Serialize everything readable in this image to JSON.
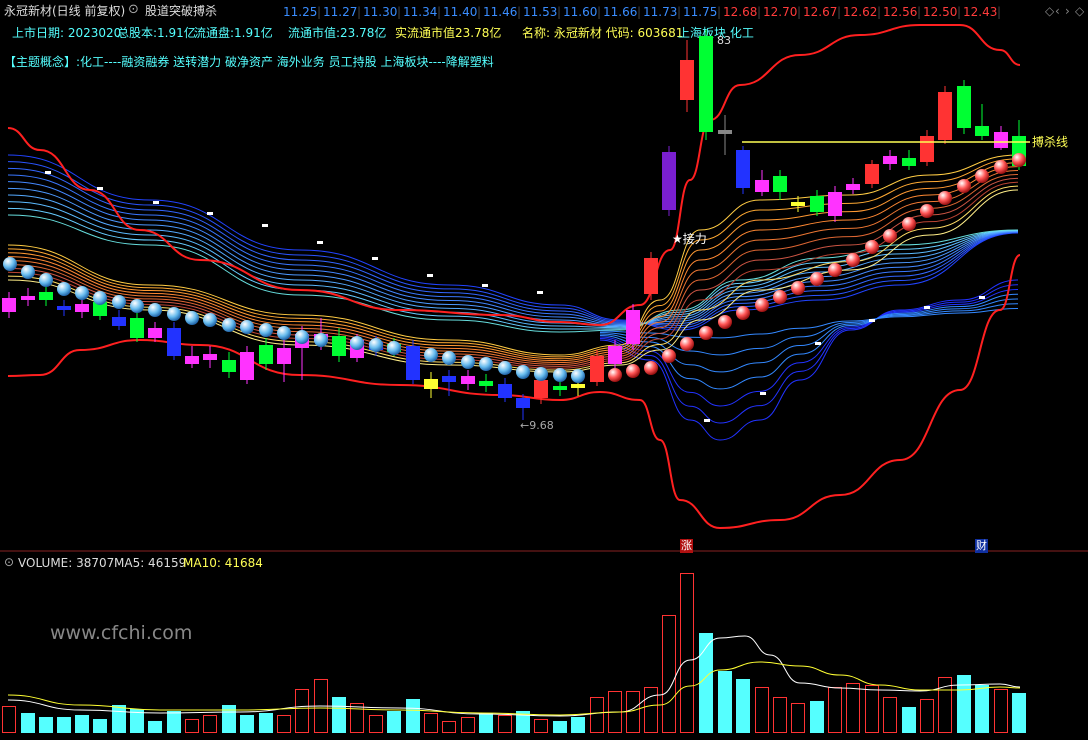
{
  "header": {
    "stock_title": "永冠新材(日线 前复权)",
    "indicator_name": "股道突破搏杀",
    "ticker_prices": [
      {
        "v": "11.25",
        "c": "#3a8dff"
      },
      {
        "v": "11.27",
        "c": "#3a8dff"
      },
      {
        "v": "11.30",
        "c": "#3a8dff"
      },
      {
        "v": "11.34",
        "c": "#3a8dff"
      },
      {
        "v": "11.40",
        "c": "#3a8dff"
      },
      {
        "v": "11.46",
        "c": "#3a8dff"
      },
      {
        "v": "11.53",
        "c": "#3a8dff"
      },
      {
        "v": "11.60",
        "c": "#3a8dff"
      },
      {
        "v": "11.66",
        "c": "#3a8dff"
      },
      {
        "v": "11.73",
        "c": "#3a8dff"
      },
      {
        "v": "11.75",
        "c": "#3a8dff"
      },
      {
        "v": "12.68",
        "c": "#ff3b3b"
      },
      {
        "v": "12.70",
        "c": "#ff3b3b"
      },
      {
        "v": "12.67",
        "c": "#ff3b3b"
      },
      {
        "v": "12.62",
        "c": "#ff3b3b"
      },
      {
        "v": "12.56",
        "c": "#ff3b3b"
      },
      {
        "v": "12.50",
        "c": "#ff3b3b"
      },
      {
        "v": "12.43",
        "c": "#ff3b3b"
      }
    ],
    "window_controls": [
      "◇",
      "‹",
      "›",
      "◇"
    ]
  },
  "info": {
    "listing_date": "上市日期: 2023020",
    "total_shares": "总股本:1.91亿",
    "float_shares": "流通盘:1.91亿",
    "float_value": "流通市值:23.78亿",
    "real_float_value": "实流通市值23.78亿",
    "name_code": "名称: 永冠新材 代码: 603681",
    "sector": "上海板块 化工",
    "concept": "【主题概念】:化工----融资融券 送转潜力 破净资产 海外业务 员工持股 上海板块----降解塑料"
  },
  "annotations": {
    "high_label": "83",
    "low_label": "←9.68",
    "support_label": "★接力",
    "kill_line_label": "搏杀线",
    "zhang_marker": "涨",
    "cai_marker": "财"
  },
  "volume": {
    "label": "VOLUME: 38707",
    "ma5": "MA5: 46159",
    "ma10": "MA10: 41684",
    "watermark": "www.cfchi.com"
  },
  "colors": {
    "up": "#ff3333",
    "down": "#00ff33",
    "blue_candle": "#2233ff",
    "magenta": "#ff33ff",
    "purple": "#7a1fd0",
    "yellow": "#ffff33",
    "cyan": "#55ffff",
    "red_line": "#ff2020",
    "kill_line": "#ffff55"
  },
  "chart_data": {
    "type": "candlestick",
    "price_min": 9.68,
    "bars": 56
  }
}
